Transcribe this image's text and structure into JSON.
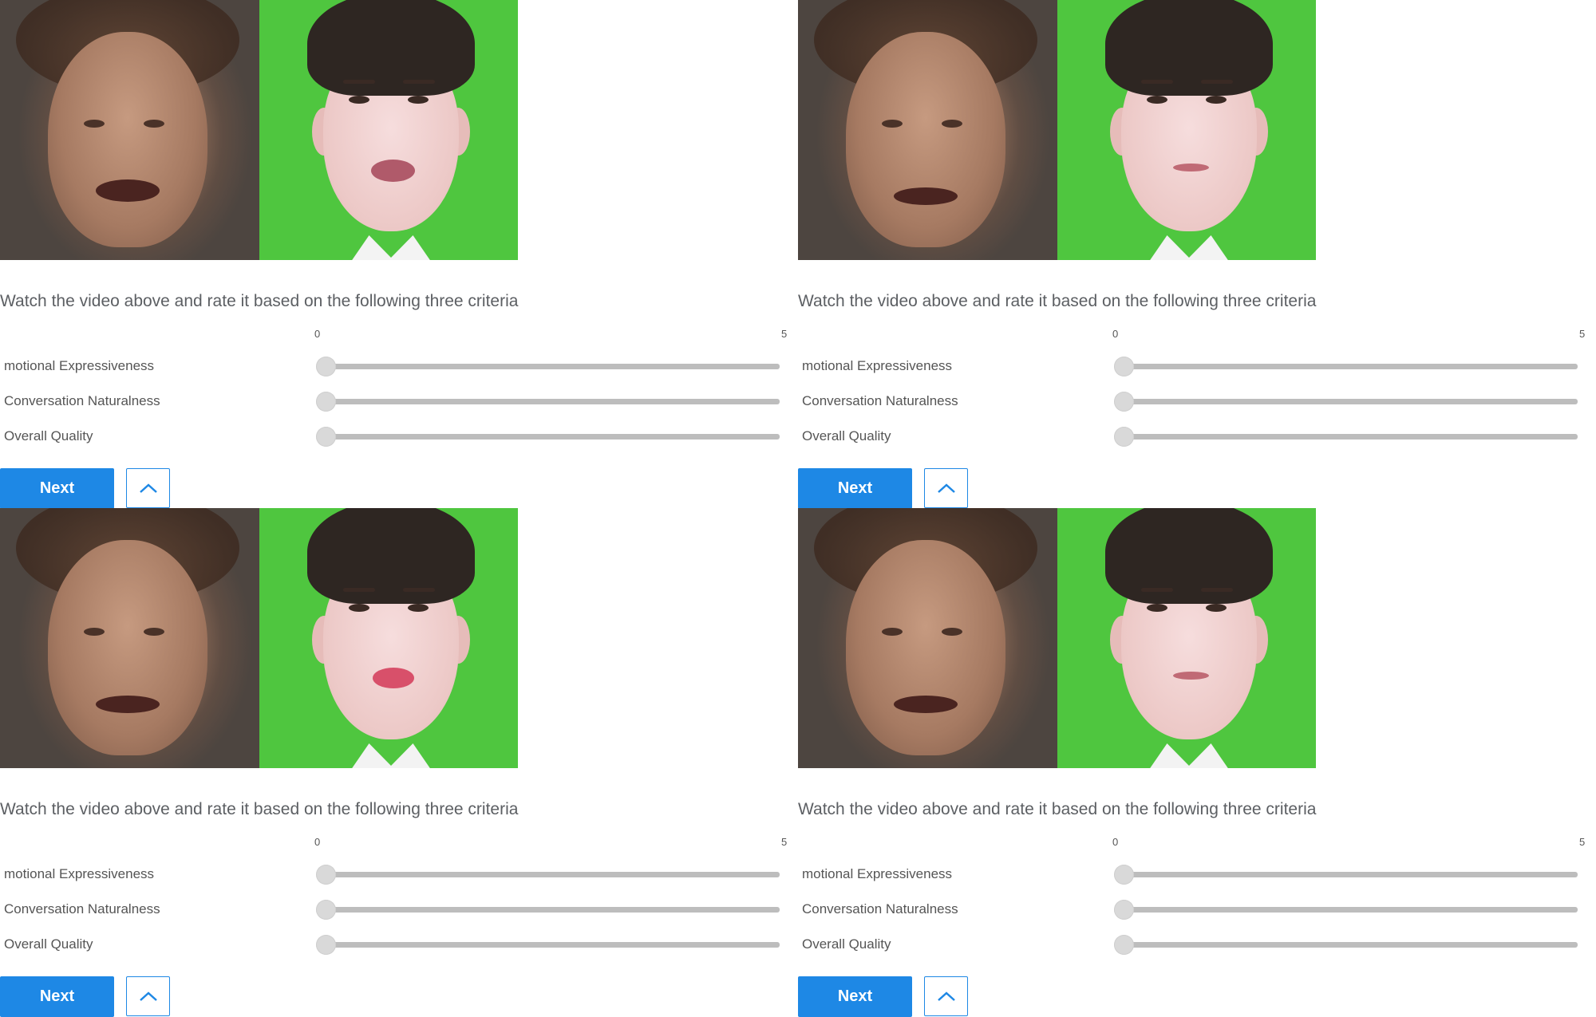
{
  "panels": [
    {
      "title": "Watch the video above and rate it based on the following three criteria",
      "scale_min": "0",
      "scale_max": "5",
      "criteria": [
        {
          "label": "motional Expressiveness",
          "value": 0
        },
        {
          "label": "Conversation Naturalness",
          "value": 0
        },
        {
          "label": "Overall Quality",
          "value": 0
        }
      ],
      "next_label": "Next",
      "up_icon": "chevron-up-icon"
    },
    {
      "title": "Watch the video above and rate it based on the following three criteria",
      "scale_min": "0",
      "scale_max": "5",
      "criteria": [
        {
          "label": "motional Expressiveness",
          "value": 0
        },
        {
          "label": "Conversation Naturalness",
          "value": 0
        },
        {
          "label": "Overall Quality",
          "value": 0
        }
      ],
      "next_label": "Next",
      "up_icon": "chevron-up-icon"
    },
    {
      "title": "Watch the video above and rate it based on the following three criteria",
      "scale_min": "0",
      "scale_max": "5",
      "criteria": [
        {
          "label": "motional Expressiveness",
          "value": 0
        },
        {
          "label": "Conversation Naturalness",
          "value": 0
        },
        {
          "label": "Overall Quality",
          "value": 0
        }
      ],
      "next_label": "Next",
      "up_icon": "chevron-up-icon"
    },
    {
      "title": "Watch the video above and rate it based on the following three criteria",
      "scale_min": "0",
      "scale_max": "5",
      "criteria": [
        {
          "label": "motional Expressiveness",
          "value": 0
        },
        {
          "label": "Conversation Naturalness",
          "value": 0
        },
        {
          "label": "Overall Quality",
          "value": 0
        }
      ],
      "next_label": "Next",
      "up_icon": "chevron-up-icon"
    }
  ],
  "colors": {
    "accent": "#1e88e5",
    "green_screen": "#4fc63f",
    "track": "#bdbdbd",
    "thumb": "#d9d9d9"
  }
}
